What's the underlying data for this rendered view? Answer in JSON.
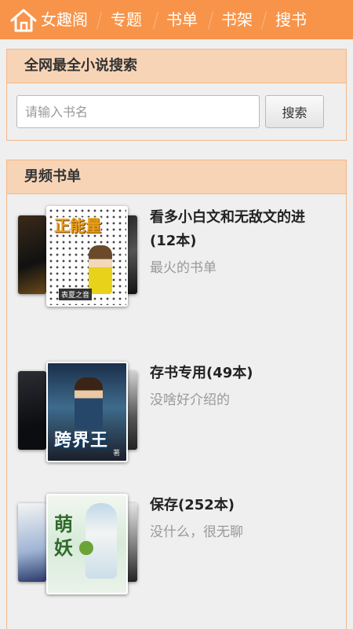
{
  "nav": {
    "logo_label": "女趣阁",
    "items": [
      "专题",
      "书单",
      "书架",
      "搜书"
    ],
    "bg_color": "#f7944a"
  },
  "search_panel": {
    "title": "全网最全小说搜索",
    "placeholder": "请输入书名",
    "button_label": "搜索"
  },
  "list_panel": {
    "title": "男频书单",
    "items": [
      {
        "title": "看多小白文和无敌文的进(12本)",
        "desc": "最火的书单",
        "cover_text": "正能量",
        "cover_footer": "表夏之音"
      },
      {
        "title": "存书专用(49本)",
        "desc": "没啥好介绍的",
        "cover_text": "跨界王",
        "cover_footer": "著"
      },
      {
        "title": "保存(252本)",
        "desc": "没什么，很无聊",
        "cover_text": "萌妖",
        "cover_footer": ""
      }
    ]
  }
}
